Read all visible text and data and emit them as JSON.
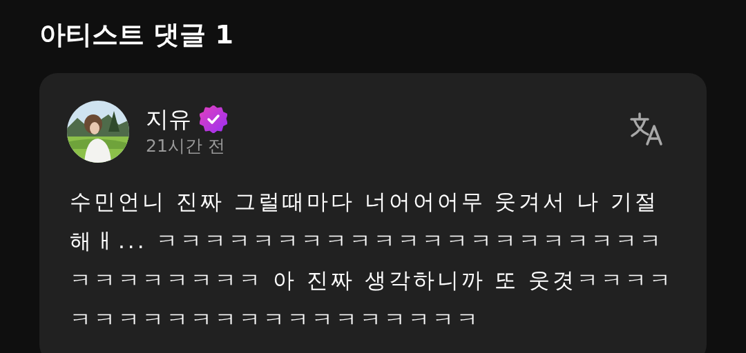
{
  "section": {
    "title": "아티스트 댓글 1"
  },
  "comment": {
    "author": "지유",
    "verified": true,
    "time": "21시간 전",
    "text": "수민언니 진짜 그럴때마다 너어어어무 웃겨서 나 기절해ㅐ... ㅋㅋㅋㅋㅋㅋㅋㅋㅋㅋㅋㅋㅋㅋㅋㅋㅋㅋㅋㅋㅋㅋㅋㅋㅋㅋㅋㅋㅋ 아 진짜 생각하니까 또 웃겻ㅋㅋㅋㅋㅋㅋㅋㅋㅋㅋㅋㅋㅋㅋㅋㅋㅋㅋㅋㅋㅋ"
  }
}
